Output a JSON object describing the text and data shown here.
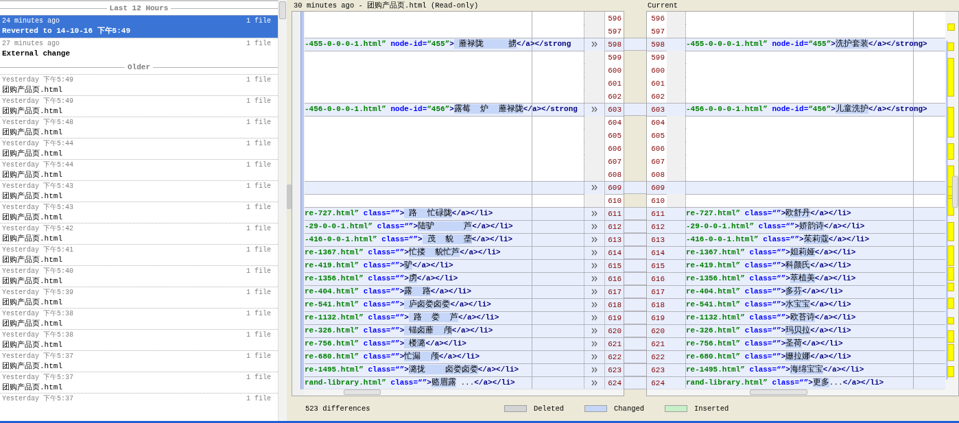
{
  "history": {
    "groups": [
      {
        "label": "Last 12 Hours",
        "entries": [
          {
            "time": "24 minutes ago",
            "count": "1 file",
            "label": "Reverted to 14-10-16 下午5:49",
            "kind": "event",
            "selected": true
          },
          {
            "time": "27 minutes ago",
            "count": "1 file",
            "label": "External change",
            "kind": "event",
            "selected": false
          }
        ]
      },
      {
        "label": "Older",
        "entries": [
          {
            "time": "Yesterday 下午5:49",
            "count": "1 file",
            "label": "团购产品页.html",
            "kind": "file",
            "selected": false
          },
          {
            "time": "Yesterday 下午5:49",
            "count": "1 file",
            "label": "团购产品页.html",
            "kind": "file",
            "selected": false
          },
          {
            "time": "Yesterday 下午5:48",
            "count": "1 file",
            "label": "团购产品页.html",
            "kind": "file",
            "selected": false
          },
          {
            "time": "Yesterday 下午5:44",
            "count": "1 file",
            "label": "团购产品页.html",
            "kind": "file",
            "selected": false
          },
          {
            "time": "Yesterday 下午5:44",
            "count": "1 file",
            "label": "团购产品页.html",
            "kind": "file",
            "selected": false
          },
          {
            "time": "Yesterday 下午5:43",
            "count": "1 file",
            "label": "团购产品页.html",
            "kind": "file",
            "selected": false
          },
          {
            "time": "Yesterday 下午5:43",
            "count": "1 file",
            "label": "团购产品页.html",
            "kind": "file",
            "selected": false
          },
          {
            "time": "Yesterday 下午5:42",
            "count": "1 file",
            "label": "团购产品页.html",
            "kind": "file",
            "selected": false
          },
          {
            "time": "Yesterday 下午5:41",
            "count": "1 file",
            "label": "团购产品页.html",
            "kind": "file",
            "selected": false
          },
          {
            "time": "Yesterday 下午5:40",
            "count": "1 file",
            "label": "团购产品页.html",
            "kind": "file",
            "selected": false
          },
          {
            "time": "Yesterday 下午5:39",
            "count": "1 file",
            "label": "团购产品页.html",
            "kind": "file",
            "selected": false
          },
          {
            "time": "Yesterday 下午5:38",
            "count": "1 file",
            "label": "团购产品页.html",
            "kind": "file",
            "selected": false
          },
          {
            "time": "Yesterday 下午5:38",
            "count": "1 file",
            "label": "团购产品页.html",
            "kind": "file",
            "selected": false
          },
          {
            "time": "Yesterday 下午5:37",
            "count": "1 file",
            "label": "团购产品页.html",
            "kind": "file",
            "selected": false
          },
          {
            "time": "Yesterday 下午5:37",
            "count": "1 file",
            "label": "团购产品页.html",
            "kind": "file",
            "selected": false
          },
          {
            "time": "Yesterday 下午5:37",
            "count": "1 file",
            "kind": "file",
            "selected": false
          }
        ]
      }
    ]
  },
  "left_pane": {
    "title": "30 minutes ago - 团购产品页.html (Read-only)"
  },
  "right_pane": {
    "title": "Current"
  },
  "diff": {
    "rows": [
      {
        "left_number": "596",
        "right_number": "596",
        "kind": "same"
      },
      {
        "left_number": "597",
        "right_number": "597",
        "kind": "same"
      },
      {
        "left_number": "598",
        "right_number": "598",
        "kind": "changed",
        "left": [
          {
            "kind": "value",
            "text": "-455-0-0-0-1.html”"
          },
          {
            "kind": "attr",
            "text": " node-id="
          },
          {
            "kind": "value",
            "text": "“455”"
          },
          {
            "kind": "tag",
            "text": ">"
          },
          {
            "kind": "diff",
            "text": " 蘼禄陇     掳"
          },
          {
            "kind": "tag",
            "text": "</a></strong"
          }
        ],
        "right": [
          {
            "kind": "value",
            "text": "-455-0-0-0-1.html”"
          },
          {
            "kind": "attr",
            "text": " node-id="
          },
          {
            "kind": "value",
            "text": "“455”"
          },
          {
            "kind": "tag",
            "text": ">"
          },
          {
            "kind": "diff",
            "text": "洗护套装"
          },
          {
            "kind": "tag",
            "text": "</a></strong>"
          }
        ]
      },
      {
        "left_number": "599",
        "right_number": "599",
        "kind": "same"
      },
      {
        "left_number": "600",
        "right_number": "600",
        "kind": "same"
      },
      {
        "left_number": "601",
        "right_number": "601",
        "kind": "same"
      },
      {
        "left_number": "602",
        "right_number": "602",
        "kind": "same"
      },
      {
        "left_number": "603",
        "right_number": "603",
        "kind": "changed",
        "left": [
          {
            "kind": "value",
            "text": "-456-0-0-0-1.html”"
          },
          {
            "kind": "attr",
            "text": " node-id="
          },
          {
            "kind": "value",
            "text": "“456”"
          },
          {
            "kind": "tag",
            "text": ">"
          },
          {
            "kind": "diff",
            "text": "露莓  炉  蘼禄陇"
          },
          {
            "kind": "tag",
            "text": "</a></strong"
          }
        ],
        "right": [
          {
            "kind": "value",
            "text": "-456-0-0-0-1.html”"
          },
          {
            "kind": "attr",
            "text": " node-id="
          },
          {
            "kind": "value",
            "text": "“456”"
          },
          {
            "kind": "tag",
            "text": ">"
          },
          {
            "kind": "diff",
            "text": "儿童洗护"
          },
          {
            "kind": "tag",
            "text": "</a></strong>"
          }
        ]
      },
      {
        "left_number": "604",
        "right_number": "604",
        "kind": "same"
      },
      {
        "left_number": "605",
        "right_number": "605",
        "kind": "same"
      },
      {
        "left_number": "606",
        "right_number": "606",
        "kind": "same"
      },
      {
        "left_number": "607",
        "right_number": "607",
        "kind": "same"
      },
      {
        "left_number": "608",
        "right_number": "608",
        "kind": "same"
      },
      {
        "left_number": "609",
        "right_number": "609",
        "kind": "changed"
      },
      {
        "left_number": "610",
        "right_number": "610",
        "kind": "same"
      },
      {
        "left_number": "611",
        "right_number": "611",
        "kind": "changed",
        "left": [
          {
            "kind": "value",
            "text": "re-727.html”"
          },
          {
            "kind": "attr",
            "text": " class=“”"
          },
          {
            "kind": "tag",
            "text": ">"
          },
          {
            "kind": "diff",
            "text": " 路  忙碌陇"
          },
          {
            "kind": "tag",
            "text": "</a></li>"
          }
        ],
        "right": [
          {
            "kind": "value",
            "text": "re-727.html”"
          },
          {
            "kind": "attr",
            "text": " class=“”"
          },
          {
            "kind": "tag",
            "text": ">"
          },
          {
            "kind": "diff",
            "text": "欧舒丹"
          },
          {
            "kind": "tag",
            "text": "</a></li>"
          }
        ]
      },
      {
        "left_number": "612",
        "right_number": "612",
        "kind": "changed",
        "left": [
          {
            "kind": "value",
            "text": "-29-0-0-1.html”"
          },
          {
            "kind": "attr",
            "text": " class=“”"
          },
          {
            "kind": "tag",
            "text": ">"
          },
          {
            "kind": "diff",
            "text": "陆驴      芦"
          },
          {
            "kind": "tag",
            "text": "</a></li>"
          }
        ],
        "right": [
          {
            "kind": "value",
            "text": "-29-0-0-1.html”"
          },
          {
            "kind": "attr",
            "text": " class=“”"
          },
          {
            "kind": "tag",
            "text": ">"
          },
          {
            "kind": "diff",
            "text": "娇韵诗"
          },
          {
            "kind": "tag",
            "text": "</a></li>"
          }
        ]
      },
      {
        "left_number": "613",
        "right_number": "613",
        "kind": "changed",
        "left": [
          {
            "kind": "value",
            "text": "-416-0-0-1.html”"
          },
          {
            "kind": "attr",
            "text": " class=“”"
          },
          {
            "kind": "tag",
            "text": ">"
          },
          {
            "kind": "diff",
            "text": " 茂  貌  垄"
          },
          {
            "kind": "tag",
            "text": "</a></li>"
          }
        ],
        "right": [
          {
            "kind": "value",
            "text": "-416-0-0-1.html”"
          },
          {
            "kind": "attr",
            "text": " class=“”"
          },
          {
            "kind": "tag",
            "text": ">"
          },
          {
            "kind": "diff",
            "text": "茱莉蔻"
          },
          {
            "kind": "tag",
            "text": "</a></li>"
          }
        ]
      },
      {
        "left_number": "614",
        "right_number": "614",
        "kind": "changed",
        "left": [
          {
            "kind": "value",
            "text": "re-1367.html”"
          },
          {
            "kind": "attr",
            "text": " class=“”"
          },
          {
            "kind": "tag",
            "text": ">"
          },
          {
            "kind": "diff",
            "text": "忙搂  貌忙芦"
          },
          {
            "kind": "tag",
            "text": "</a></li>"
          }
        ],
        "right": [
          {
            "kind": "value",
            "text": "re-1367.html”"
          },
          {
            "kind": "attr",
            "text": " class=“”"
          },
          {
            "kind": "tag",
            "text": ">"
          },
          {
            "kind": "diff",
            "text": "妲莉娅"
          },
          {
            "kind": "tag",
            "text": "</a></li>"
          }
        ]
      },
      {
        "left_number": "615",
        "right_number": "615",
        "kind": "changed",
        "left": [
          {
            "kind": "value",
            "text": "re-419.html”"
          },
          {
            "kind": "attr",
            "text": " class=“”"
          },
          {
            "kind": "tag",
            "text": ">"
          },
          {
            "kind": "diff",
            "text": "驴"
          },
          {
            "kind": "tag",
            "text": "</a></li>"
          }
        ],
        "right": [
          {
            "kind": "value",
            "text": "re-419.html”"
          },
          {
            "kind": "attr",
            "text": " class=“”"
          },
          {
            "kind": "tag",
            "text": ">"
          },
          {
            "kind": "diff",
            "text": "科颜氏"
          },
          {
            "kind": "tag",
            "text": "</a></li>"
          }
        ]
      },
      {
        "left_number": "616",
        "right_number": "616",
        "kind": "changed",
        "left": [
          {
            "kind": "value",
            "text": "re-1356.html”"
          },
          {
            "kind": "attr",
            "text": " class=“”"
          },
          {
            "kind": "tag",
            "text": ">"
          },
          {
            "kind": "diff",
            "text": "虏"
          },
          {
            "kind": "tag",
            "text": "</a></li>"
          }
        ],
        "right": [
          {
            "kind": "value",
            "text": "re-1356.html”"
          },
          {
            "kind": "attr",
            "text": " class=“”"
          },
          {
            "kind": "tag",
            "text": ">"
          },
          {
            "kind": "diff",
            "text": "萃植美"
          },
          {
            "kind": "tag",
            "text": "</a></li>"
          }
        ]
      },
      {
        "left_number": "617",
        "right_number": "617",
        "kind": "changed",
        "left": [
          {
            "kind": "value",
            "text": "re-404.html”"
          },
          {
            "kind": "attr",
            "text": " class=“”"
          },
          {
            "kind": "tag",
            "text": ">"
          },
          {
            "kind": "diff",
            "text": "露  路"
          },
          {
            "kind": "tag",
            "text": "</a></li>"
          }
        ],
        "right": [
          {
            "kind": "value",
            "text": "re-404.html”"
          },
          {
            "kind": "attr",
            "text": " class=“”"
          },
          {
            "kind": "tag",
            "text": ">"
          },
          {
            "kind": "diff",
            "text": "多芬"
          },
          {
            "kind": "tag",
            "text": "</a></li>"
          }
        ]
      },
      {
        "left_number": "618",
        "right_number": "618",
        "kind": "changed",
        "left": [
          {
            "kind": "value",
            "text": "re-541.html”"
          },
          {
            "kind": "attr",
            "text": " class=“”"
          },
          {
            "kind": "tag",
            "text": ">"
          },
          {
            "kind": "diff",
            "text": " 庐卤娄卤娄"
          },
          {
            "kind": "tag",
            "text": "</a></li>"
          }
        ],
        "right": [
          {
            "kind": "value",
            "text": "re-541.html”"
          },
          {
            "kind": "attr",
            "text": " class=“”"
          },
          {
            "kind": "tag",
            "text": ">"
          },
          {
            "kind": "diff",
            "text": "水宝宝"
          },
          {
            "kind": "tag",
            "text": "</a></li>"
          }
        ]
      },
      {
        "left_number": "619",
        "right_number": "619",
        "kind": "changed",
        "left": [
          {
            "kind": "value",
            "text": "re-1132.html”"
          },
          {
            "kind": "attr",
            "text": " class=“”"
          },
          {
            "kind": "tag",
            "text": ">"
          },
          {
            "kind": "diff",
            "text": " 路  娄  芦"
          },
          {
            "kind": "tag",
            "text": "</a></li>"
          }
        ],
        "right": [
          {
            "kind": "value",
            "text": "re-1132.html”"
          },
          {
            "kind": "attr",
            "text": " class=“”"
          },
          {
            "kind": "tag",
            "text": ">"
          },
          {
            "kind": "diff",
            "text": "欧苔诗"
          },
          {
            "kind": "tag",
            "text": "</a></li>"
          }
        ]
      },
      {
        "left_number": "620",
        "right_number": "620",
        "kind": "changed",
        "left": [
          {
            "kind": "value",
            "text": "re-326.html”"
          },
          {
            "kind": "attr",
            "text": " class=“”"
          },
          {
            "kind": "tag",
            "text": ">"
          },
          {
            "kind": "diff",
            "text": " 锚卤蘼  颅"
          },
          {
            "kind": "tag",
            "text": "</a></li>"
          }
        ],
        "right": [
          {
            "kind": "value",
            "text": "re-326.html”"
          },
          {
            "kind": "attr",
            "text": " class=“”"
          },
          {
            "kind": "tag",
            "text": ">"
          },
          {
            "kind": "diff",
            "text": "玛贝拉"
          },
          {
            "kind": "tag",
            "text": "</a></li>"
          }
        ]
      },
      {
        "left_number": "621",
        "right_number": "621",
        "kind": "changed",
        "left": [
          {
            "kind": "value",
            "text": "re-756.html”"
          },
          {
            "kind": "attr",
            "text": " class=“”"
          },
          {
            "kind": "tag",
            "text": ">"
          },
          {
            "kind": "diff",
            "text": " 楼潞"
          },
          {
            "kind": "tag",
            "text": "</a></li>"
          }
        ],
        "right": [
          {
            "kind": "value",
            "text": "re-756.html”"
          },
          {
            "kind": "attr",
            "text": " class=“”"
          },
          {
            "kind": "tag",
            "text": ">"
          },
          {
            "kind": "diff",
            "text": "圣荷"
          },
          {
            "kind": "tag",
            "text": "</a></li>"
          }
        ]
      },
      {
        "left_number": "622",
        "right_number": "622",
        "kind": "changed",
        "left": [
          {
            "kind": "value",
            "text": "re-680.html”"
          },
          {
            "kind": "attr",
            "text": " class=“”"
          },
          {
            "kind": "tag",
            "text": ">"
          },
          {
            "kind": "diff",
            "text": "忙漏  颅"
          },
          {
            "kind": "tag",
            "text": "</a></li>"
          }
        ],
        "right": [
          {
            "kind": "value",
            "text": "re-680.html”"
          },
          {
            "kind": "attr",
            "text": " class=“”"
          },
          {
            "kind": "tag",
            "text": ">"
          },
          {
            "kind": "diff",
            "text": "姗拉娜"
          },
          {
            "kind": "tag",
            "text": "</a></li>"
          }
        ]
      },
      {
        "left_number": "623",
        "right_number": "623",
        "kind": "changed",
        "left": [
          {
            "kind": "value",
            "text": "re-1495.html”"
          },
          {
            "kind": "attr",
            "text": " class=“”"
          },
          {
            "kind": "tag",
            "text": ">"
          },
          {
            "kind": "diff",
            "text": "潞拢    卤娄卤娄"
          },
          {
            "kind": "tag",
            "text": "</a></li>"
          }
        ],
        "right": [
          {
            "kind": "value",
            "text": "re-1495.html”"
          },
          {
            "kind": "attr",
            "text": " class=“”"
          },
          {
            "kind": "tag",
            "text": ">"
          },
          {
            "kind": "diff",
            "text": "海绵宝宝"
          },
          {
            "kind": "tag",
            "text": "</a></li>"
          }
        ]
      },
      {
        "left_number": "624",
        "right_number": "624",
        "kind": "changed",
        "left": [
          {
            "kind": "value",
            "text": "rand-library.html”"
          },
          {
            "kind": "attr",
            "text": " class=“”"
          },
          {
            "kind": "tag",
            "text": ">"
          },
          {
            "kind": "diff",
            "text": "赂眉露"
          },
          {
            "kind": "text",
            "text": " ..."
          },
          {
            "kind": "tag",
            "text": "</a></li>"
          }
        ],
        "right": [
          {
            "kind": "value",
            "text": "rand-library.html”"
          },
          {
            "kind": "attr",
            "text": " class=“”"
          },
          {
            "kind": "tag",
            "text": ">"
          },
          {
            "kind": "diff",
            "text": "更多"
          },
          {
            "kind": "text",
            "text": "..."
          },
          {
            "kind": "tag",
            "text": "</a></li>"
          }
        ]
      }
    ]
  },
  "status_bar": {
    "summary": "523 differences",
    "legend": [
      {
        "label": "Deleted",
        "color": "#d4d4d4"
      },
      {
        "label": "Changed",
        "color": "#c6d6f8"
      },
      {
        "label": "Inserted",
        "color": "#c8f0c8"
      }
    ]
  }
}
